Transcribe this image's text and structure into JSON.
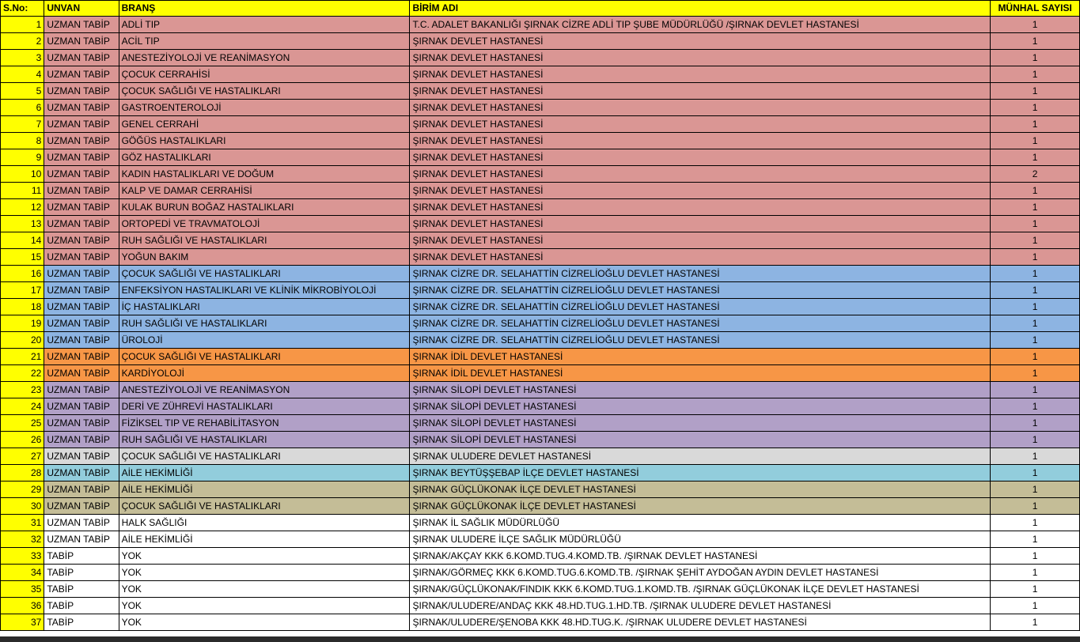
{
  "headers": [
    "S.No:",
    "UNVAN",
    "BRANŞ",
    "BİRİM ADI",
    "MÜNHAL SAYISI"
  ],
  "colors": {
    "header": "#ffff00",
    "sno": "#ffff00",
    "pink": "#da9694",
    "blue": "#8db4e2",
    "orange": "#f79646",
    "purple": "#b1a0c7",
    "gray": "#d9d9d9",
    "teal": "#92cddc",
    "khaki": "#c4bd97",
    "white": "#ffffff"
  },
  "rows": [
    {
      "no": "1",
      "unvan": "UZMAN TABİP",
      "brans": "ADLİ TIP",
      "birim": "T.C. ADALET BAKANLIĞI ŞIRNAK CİZRE ADLİ TIP ŞUBE MÜDÜRLÜĞÜ /ŞIRNAK DEVLET HASTANESİ",
      "sayi": "1",
      "color": "pink"
    },
    {
      "no": "2",
      "unvan": "UZMAN TABİP",
      "brans": "ACİL TIP",
      "birim": "ŞIRNAK DEVLET HASTANESİ",
      "sayi": "1",
      "color": "pink"
    },
    {
      "no": "3",
      "unvan": "UZMAN TABİP",
      "brans": "ANESTEZİYOLOJİ VE REANİMASYON",
      "birim": "ŞIRNAK DEVLET HASTANESİ",
      "sayi": "1",
      "color": "pink"
    },
    {
      "no": "4",
      "unvan": "UZMAN TABİP",
      "brans": "ÇOCUK CERRAHİSİ",
      "birim": "ŞIRNAK DEVLET HASTANESİ",
      "sayi": "1",
      "color": "pink"
    },
    {
      "no": "5",
      "unvan": "UZMAN TABİP",
      "brans": "ÇOCUK SAĞLIĞI VE HASTALIKLARI",
      "birim": "ŞIRNAK DEVLET HASTANESİ",
      "sayi": "1",
      "color": "pink"
    },
    {
      "no": "6",
      "unvan": "UZMAN TABİP",
      "brans": "GASTROENTEROLOJİ",
      "birim": "ŞIRNAK DEVLET HASTANESİ",
      "sayi": "1",
      "color": "pink"
    },
    {
      "no": "7",
      "unvan": "UZMAN TABİP",
      "brans": "GENEL CERRAHİ",
      "birim": "ŞIRNAK DEVLET HASTANESİ",
      "sayi": "1",
      "color": "pink"
    },
    {
      "no": "8",
      "unvan": "UZMAN TABİP",
      "brans": "GÖĞÜS HASTALIKLARI",
      "birim": "ŞIRNAK DEVLET HASTANESİ",
      "sayi": "1",
      "color": "pink"
    },
    {
      "no": "9",
      "unvan": "UZMAN TABİP",
      "brans": "GÖZ HASTALIKLARI",
      "birim": "ŞIRNAK DEVLET HASTANESİ",
      "sayi": "1",
      "color": "pink"
    },
    {
      "no": "10",
      "unvan": "UZMAN TABİP",
      "brans": "KADIN HASTALIKLARI VE DOĞUM",
      "birim": "ŞIRNAK DEVLET HASTANESİ",
      "sayi": "2",
      "color": "pink"
    },
    {
      "no": "11",
      "unvan": "UZMAN TABİP",
      "brans": "KALP VE DAMAR CERRAHİSİ",
      "birim": "ŞIRNAK DEVLET HASTANESİ",
      "sayi": "1",
      "color": "pink"
    },
    {
      "no": "12",
      "unvan": "UZMAN TABİP",
      "brans": "KULAK BURUN BOĞAZ HASTALIKLARI",
      "birim": "ŞIRNAK DEVLET HASTANESİ",
      "sayi": "1",
      "color": "pink"
    },
    {
      "no": "13",
      "unvan": "UZMAN TABİP",
      "brans": "ORTOPEDİ VE TRAVMATOLOJİ",
      "birim": "ŞIRNAK DEVLET HASTANESİ",
      "sayi": "1",
      "color": "pink"
    },
    {
      "no": "14",
      "unvan": "UZMAN TABİP",
      "brans": "RUH SAĞLIĞI VE HASTALIKLARI",
      "birim": "ŞIRNAK DEVLET HASTANESİ",
      "sayi": "1",
      "color": "pink"
    },
    {
      "no": "15",
      "unvan": "UZMAN TABİP",
      "brans": "YOĞUN BAKIM",
      "birim": "ŞIRNAK DEVLET HASTANESİ",
      "sayi": "1",
      "color": "pink"
    },
    {
      "no": "16",
      "unvan": "UZMAN TABİP",
      "brans": "ÇOCUK SAĞLIĞI VE HASTALIKLARI",
      "birim": "ŞIRNAK CİZRE DR. SELAHATTİN CİZRELİOĞLU DEVLET HASTANESİ",
      "sayi": "1",
      "color": "blue"
    },
    {
      "no": "17",
      "unvan": "UZMAN TABİP",
      "brans": "ENFEKSİYON HASTALIKLARI VE KLİNİK MİKROBİYOLOJİ",
      "birim": "ŞIRNAK CİZRE DR. SELAHATTİN CİZRELİOĞLU DEVLET HASTANESİ",
      "sayi": "1",
      "color": "blue"
    },
    {
      "no": "18",
      "unvan": "UZMAN TABİP",
      "brans": "İÇ HASTALIKLARI",
      "birim": "ŞIRNAK CİZRE DR. SELAHATTİN CİZRELİOĞLU DEVLET HASTANESİ",
      "sayi": "1",
      "color": "blue"
    },
    {
      "no": "19",
      "unvan": "UZMAN TABİP",
      "brans": "RUH SAĞLIĞI VE HASTALIKLARI",
      "birim": "ŞIRNAK CİZRE DR. SELAHATTİN CİZRELİOĞLU DEVLET HASTANESİ",
      "sayi": "1",
      "color": "blue"
    },
    {
      "no": "20",
      "unvan": "UZMAN TABİP",
      "brans": "ÜROLOJİ",
      "birim": "ŞIRNAK CİZRE DR. SELAHATTİN CİZRELİOĞLU DEVLET HASTANESİ",
      "sayi": "1",
      "color": "blue"
    },
    {
      "no": "21",
      "unvan": "UZMAN TABİP",
      "brans": "ÇOCUK SAĞLIĞI VE HASTALIKLARI",
      "birim": "ŞIRNAK İDİL DEVLET HASTANESİ",
      "sayi": "1",
      "color": "orange"
    },
    {
      "no": "22",
      "unvan": "UZMAN TABİP",
      "brans": "KARDİYOLOJİ",
      "birim": "ŞIRNAK İDİL DEVLET HASTANESİ",
      "sayi": "1",
      "color": "orange"
    },
    {
      "no": "23",
      "unvan": "UZMAN TABİP",
      "brans": "ANESTEZİYOLOJİ VE REANİMASYON",
      "birim": "ŞIRNAK SİLOPİ DEVLET HASTANESİ",
      "sayi": "1",
      "color": "purple"
    },
    {
      "no": "24",
      "unvan": "UZMAN TABİP",
      "brans": "DERİ VE ZÜHREVİ HASTALIKLARI",
      "birim": "ŞIRNAK SİLOPİ DEVLET HASTANESİ",
      "sayi": "1",
      "color": "purple"
    },
    {
      "no": "25",
      "unvan": "UZMAN TABİP",
      "brans": "FİZİKSEL TIP VE REHABİLİTASYON",
      "birim": "ŞIRNAK SİLOPİ DEVLET HASTANESİ",
      "sayi": "1",
      "color": "purple"
    },
    {
      "no": "26",
      "unvan": "UZMAN TABİP",
      "brans": "RUH SAĞLIĞI VE HASTALIKLARI",
      "birim": "ŞIRNAK SİLOPİ DEVLET HASTANESİ",
      "sayi": "1",
      "color": "purple"
    },
    {
      "no": "27",
      "unvan": "UZMAN TABİP",
      "brans": "ÇOCUK SAĞLIĞI VE HASTALIKLARI",
      "birim": "ŞIRNAK ULUDERE DEVLET HASTANESİ",
      "sayi": "1",
      "color": "gray"
    },
    {
      "no": "28",
      "unvan": "UZMAN TABİP",
      "brans": "AİLE HEKİMLİĞİ",
      "birim": "ŞIRNAK BEYTÜŞŞEBAP İLÇE DEVLET HASTANESİ",
      "sayi": "1",
      "color": "teal"
    },
    {
      "no": "29",
      "unvan": "UZMAN TABİP",
      "brans": "AİLE HEKİMLİĞİ",
      "birim": "ŞIRNAK GÜÇLÜKONAK İLÇE DEVLET HASTANESİ",
      "sayi": "1",
      "color": "khaki"
    },
    {
      "no": "30",
      "unvan": "UZMAN TABİP",
      "brans": "ÇOCUK SAĞLIĞI VE HASTALIKLARI",
      "birim": "ŞIRNAK GÜÇLÜKONAK İLÇE DEVLET HASTANESİ",
      "sayi": "1",
      "color": "khaki"
    },
    {
      "no": "31",
      "unvan": "UZMAN TABİP",
      "brans": "HALK SAĞLIĞI",
      "birim": "ŞIRNAK İL SAĞLIK MÜDÜRLÜĞÜ",
      "sayi": "1",
      "color": "white"
    },
    {
      "no": "32",
      "unvan": "UZMAN TABİP",
      "brans": "AİLE HEKİMLİĞİ",
      "birim": "ŞIRNAK ULUDERE İLÇE SAĞLIK MÜDÜRLÜĞÜ",
      "sayi": "1",
      "color": "white"
    },
    {
      "no": "33",
      "unvan": "TABİP",
      "brans": "YOK",
      "birim": "ŞIRNAK/AKÇAY KKK 6.KOMD.TUG.4.KOMD.TB. /ŞIRNAK DEVLET HASTANESİ",
      "sayi": "1",
      "color": "white"
    },
    {
      "no": "34",
      "unvan": "TABİP",
      "brans": "YOK",
      "birim": "ŞIRNAK/GÖRMEÇ KKK 6.KOMD.TUG.6.KOMD.TB. /ŞIRNAK ŞEHİT AYDOĞAN AYDIN DEVLET HASTANESİ",
      "sayi": "1",
      "color": "white"
    },
    {
      "no": "35",
      "unvan": "TABİP",
      "brans": "YOK",
      "birim": "ŞIRNAK/GÜÇLÜKONAK/FINDIK KKK 6.KOMD.TUG.1.KOMD.TB. /ŞIRNAK GÜÇLÜKONAK İLÇE DEVLET HASTANESİ",
      "sayi": "1",
      "color": "white"
    },
    {
      "no": "36",
      "unvan": "TABİP",
      "brans": "YOK",
      "birim": "ŞIRNAK/ULUDERE/ANDAÇ KKK 48.HD.TUG.1.HD.TB. /ŞIRNAK ULUDERE DEVLET HASTANESİ",
      "sayi": "1",
      "color": "white"
    },
    {
      "no": "37",
      "unvan": "TABİP",
      "brans": "YOK",
      "birim": "ŞIRNAK/ULUDERE/ŞENOBA KKK 48.HD.TUG.K. /ŞIRNAK ULUDERE DEVLET HASTANESİ",
      "sayi": "1",
      "color": "white"
    }
  ]
}
